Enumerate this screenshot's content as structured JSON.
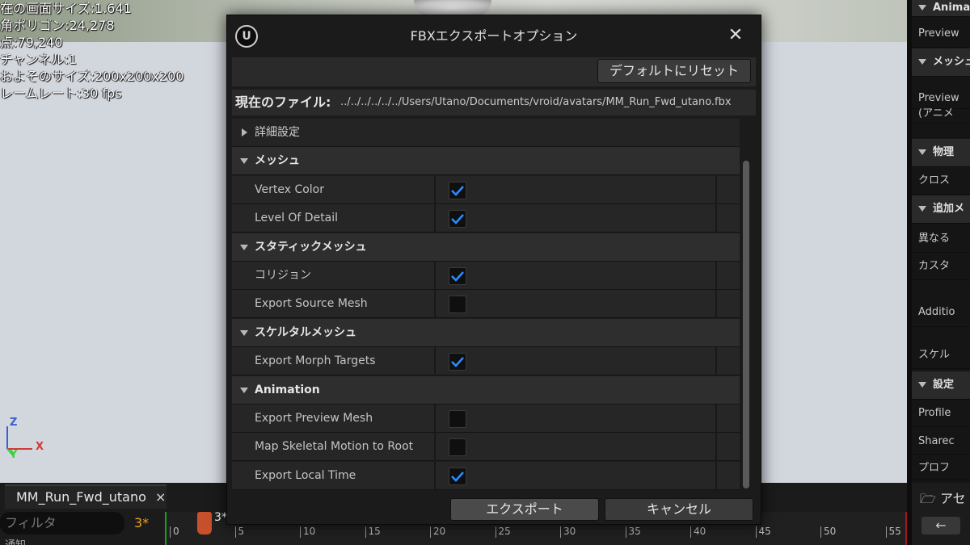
{
  "viewport": {
    "stats": [
      "在の画面サイズ:1.641",
      "角ポリゴン:24,278",
      "点:79,240",
      "チャンネル:1",
      "およそのサイズ:200x200x200",
      "レームレート:30 fps"
    ],
    "axis": {
      "z": "Z",
      "x": "X",
      "y": "Y"
    }
  },
  "right_panel": {
    "rows": [
      {
        "kind": "cat",
        "label": "Anima"
      },
      {
        "kind": "item",
        "label": "Preview"
      },
      {
        "kind": "cat",
        "label": "メッシュ"
      },
      {
        "kind": "item",
        "label": "Preview"
      },
      {
        "kind": "item",
        "label": "(アニメ"
      },
      {
        "kind": "cat",
        "label": "物理"
      },
      {
        "kind": "item",
        "label": "クロス"
      },
      {
        "kind": "cat",
        "label": "追加メ"
      },
      {
        "kind": "item",
        "label": "異なる"
      },
      {
        "kind": "item",
        "label": "カスタ"
      },
      {
        "kind": "item",
        "label": "Additio"
      },
      {
        "kind": "item",
        "label": "スケル"
      },
      {
        "kind": "cat",
        "label": "設定"
      },
      {
        "kind": "item",
        "label": "Profile"
      },
      {
        "kind": "item",
        "label": "Sharec"
      },
      {
        "kind": "item",
        "label": "プロフ"
      }
    ],
    "bottom_title": "アセ",
    "back_arrow": "←"
  },
  "timeline": {
    "tab_label": "MM_Run_Fwd_utano",
    "tab_close": "×",
    "filter_placeholder": "フィルタ",
    "frame_indicator": "3*",
    "playhead_label": "3*",
    "ticks": [
      "0",
      "5",
      "10",
      "15",
      "20",
      "25",
      "30",
      "35",
      "40",
      "45",
      "50",
      "55"
    ],
    "lower_label": "通知"
  },
  "dialog": {
    "title": "FBXエクスポートオプション",
    "logo": "U",
    "close": "✕",
    "reset_label": "デフォルトにリセット",
    "current_file_label": "現在のファイル:",
    "current_file_path": "../../../../../../Users/Utano/Documents/vroid/avatars/MM_Run_Fwd_utano.fbx",
    "advanced_label": "詳細設定",
    "sections": [
      {
        "title": "メッシュ",
        "props": [
          {
            "label": "Vertex Color",
            "checked": true
          },
          {
            "label": "Level Of Detail",
            "checked": true
          }
        ]
      },
      {
        "title": "スタティックメッシュ",
        "props": [
          {
            "label": "コリジョン",
            "checked": true
          },
          {
            "label": "Export Source Mesh",
            "checked": false
          }
        ]
      },
      {
        "title": "スケルタルメッシュ",
        "props": [
          {
            "label": "Export Morph Targets",
            "checked": true
          }
        ]
      },
      {
        "title": "Animation",
        "props": [
          {
            "label": "Export Preview Mesh",
            "checked": false
          },
          {
            "label": "Map Skeletal Motion to Root",
            "checked": false
          },
          {
            "label": "Export Local Time",
            "checked": true
          }
        ]
      }
    ],
    "export_label": "エクスポート",
    "cancel_label": "キャンセル"
  },
  "colors": {
    "checkmark": "#2b8cff",
    "viewport_floor": "#d2d6dd",
    "dialog_bg": "#1b1b1b"
  }
}
